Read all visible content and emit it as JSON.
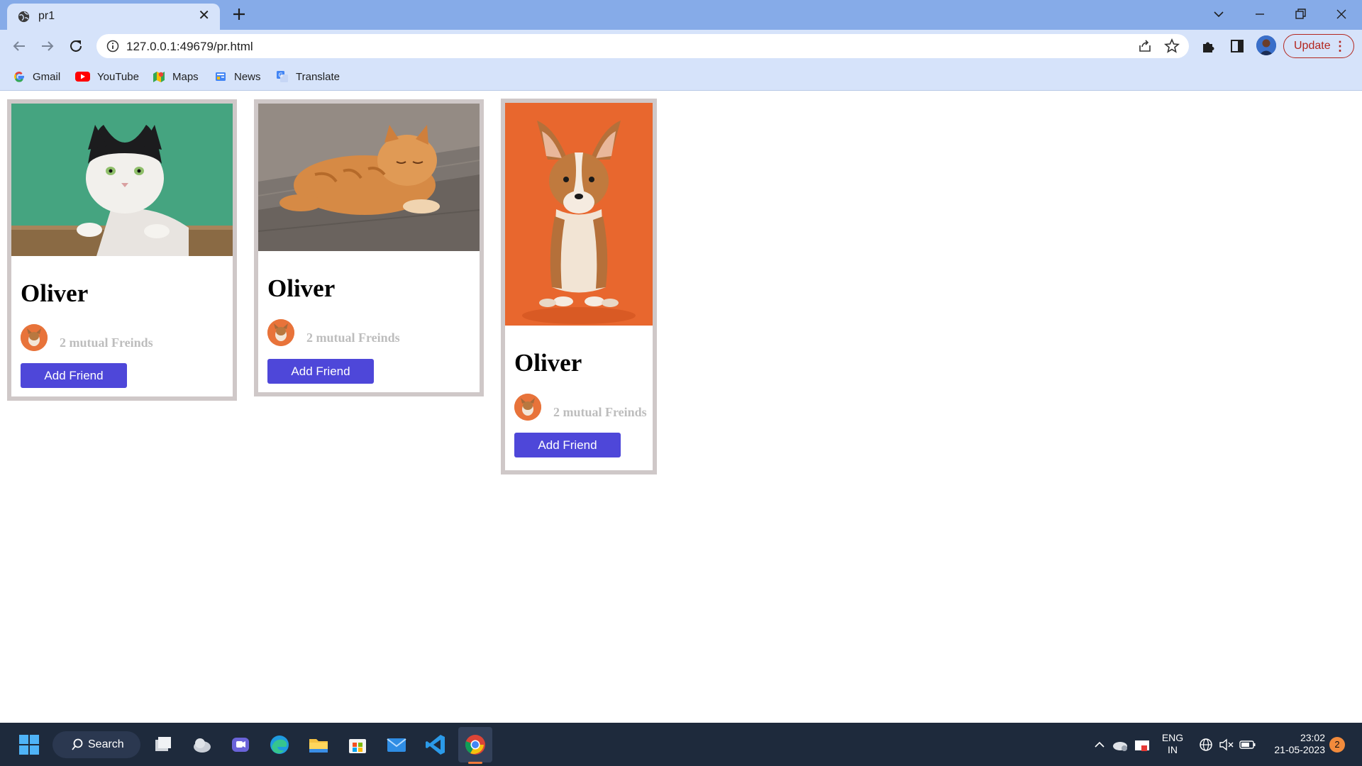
{
  "browser": {
    "tab": {
      "title": "pr1",
      "close_glyph": "✕"
    },
    "new_tab_icon": "plus-icon",
    "url": "127.0.0.1:49679/pr.html",
    "update_label": "Update",
    "menu_glyph": "⋮",
    "bookmarks": [
      {
        "label": "Gmail",
        "icon": "google-icon"
      },
      {
        "label": "YouTube",
        "icon": "youtube-icon"
      },
      {
        "label": "Maps",
        "icon": "maps-icon"
      },
      {
        "label": "News",
        "icon": "news-icon"
      },
      {
        "label": "Translate",
        "icon": "translate-icon"
      }
    ]
  },
  "cards": [
    {
      "name": "Oliver",
      "mutual": "2 mutual Freinds",
      "button": "Add Friend",
      "image": "cat-photo-black-white"
    },
    {
      "name": "Oliver",
      "mutual": "2 mutual Freinds",
      "button": "Add Friend",
      "image": "cat-photo-orange"
    },
    {
      "name": "Oliver",
      "mutual": "2 mutual Freinds",
      "button": "Add Friend",
      "image": "puppy-photo-corgi"
    }
  ],
  "taskbar": {
    "search_label": "Search",
    "lang_top": "ENG",
    "lang_bottom": "IN",
    "time": "23:02",
    "date": "21-05-2023",
    "notifications": "2"
  },
  "colors": {
    "accent_button": "#4e47d9",
    "card_border": "#cfc8c8",
    "tabbar": "#86abe8",
    "toolbar": "#d6e3fa"
  }
}
